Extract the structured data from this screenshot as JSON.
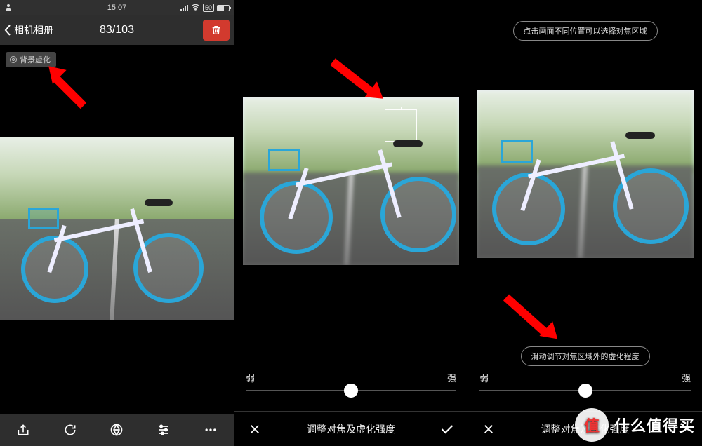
{
  "panel1": {
    "status": {
      "time": "15:07",
      "net_label": "50"
    },
    "nav": {
      "back_label": "相机相册",
      "counter": "83/103"
    },
    "badge": {
      "label": "背景虚化"
    },
    "toolbar_icons": [
      "share-icon",
      "rotate-icon",
      "aperture-icon",
      "sliders-icon",
      "more-icon"
    ]
  },
  "panel2": {
    "slider": {
      "weak": "弱",
      "strong": "强",
      "value_pct": 50
    },
    "bottom_label": "调整对焦及虚化强度"
  },
  "panel3": {
    "tip_top": "点击画面不同位置可以选择对焦区域",
    "tip_bottom": "滑动调节对焦区域外的虚化程度",
    "slider": {
      "weak": "弱",
      "strong": "强",
      "value_pct": 50
    },
    "bottom_label": "调整对焦及虚化强度"
  },
  "watermark": {
    "circle": "值",
    "text": "什么值得买"
  },
  "colors": {
    "accent_red": "#d23a2e",
    "arrow_red": "#ff0000",
    "bike_blue": "#2aa6d8"
  }
}
